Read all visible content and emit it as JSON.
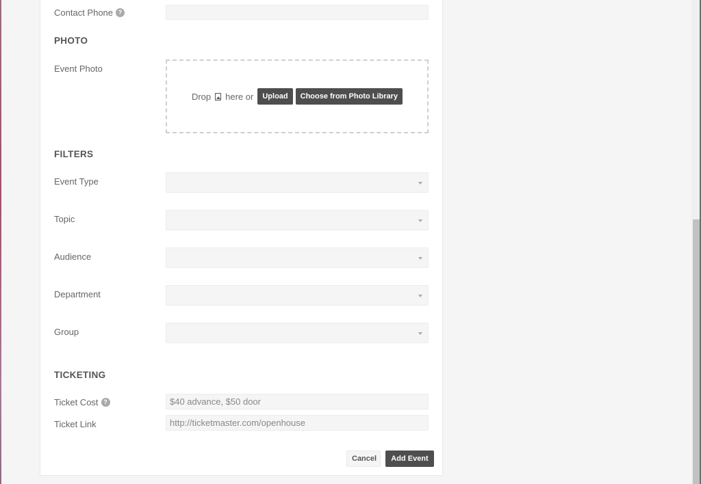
{
  "contact": {
    "phone_label": "Contact Phone",
    "phone_value": "",
    "help_glyph": "?"
  },
  "photo": {
    "section_title": "PHOTO",
    "label": "Event Photo",
    "drop_text_before": "Drop",
    "drop_icon": "image-file-icon",
    "drop_text_after": "here or",
    "upload_label": "Upload",
    "library_label": "Choose from Photo Library"
  },
  "filters": {
    "section_title": "FILTERS",
    "fields": [
      {
        "label": "Event Type",
        "value": ""
      },
      {
        "label": "Topic",
        "value": ""
      },
      {
        "label": "Audience",
        "value": ""
      },
      {
        "label": "Department",
        "value": ""
      },
      {
        "label": "Group",
        "value": ""
      }
    ]
  },
  "ticketing": {
    "section_title": "TICKETING",
    "cost_label": "Ticket Cost",
    "cost_placeholder": "$40 advance, $50 door",
    "link_label": "Ticket Link",
    "link_placeholder": "http://ticketmaster.com/openhouse",
    "help_glyph": "?"
  },
  "actions": {
    "cancel_label": "Cancel",
    "submit_label": "Add Event"
  }
}
